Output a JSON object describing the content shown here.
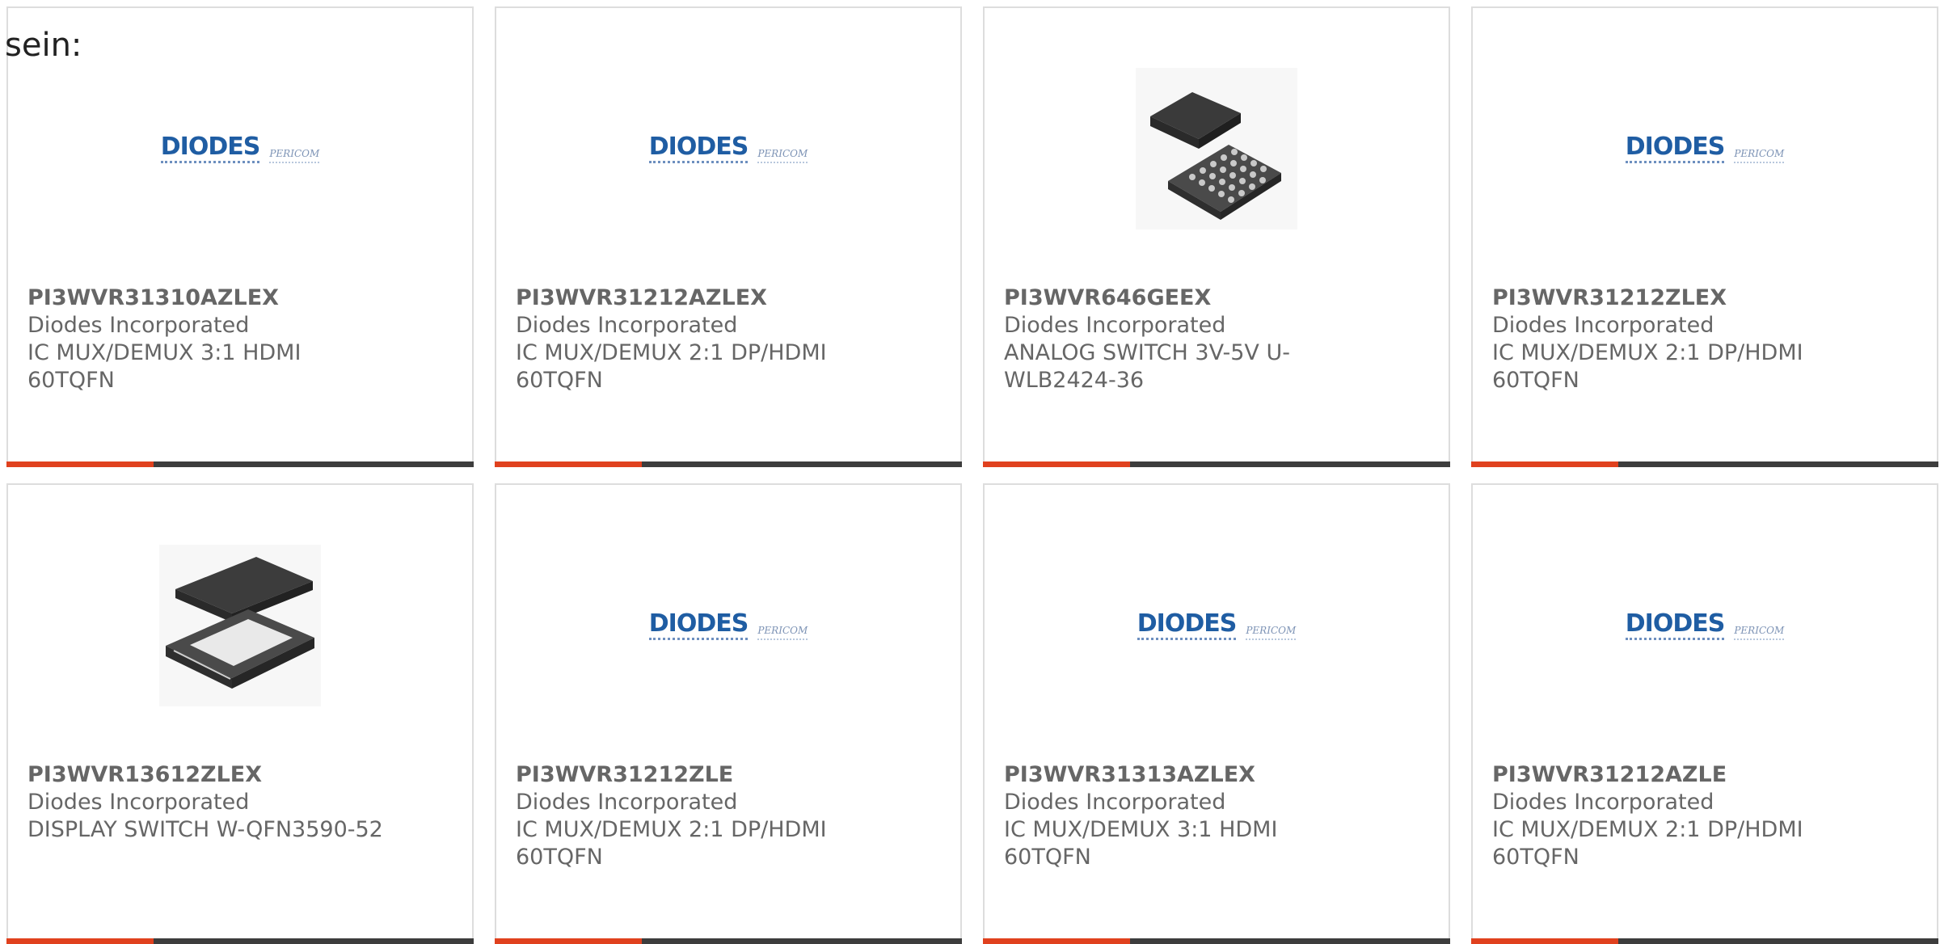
{
  "intro_text": "sein:",
  "accent_color": "#e0411e",
  "bar_color": "#3d3d3d",
  "logo": {
    "brand": "DIODES",
    "sub": "PERICOM"
  },
  "products": [
    {
      "part": "PI3WVR31310AZLEX",
      "manufacturer": "Diodes Incorporated",
      "desc1": "IC MUX/DEMUX 3:1 HDMI",
      "desc2": "60TQFN",
      "image": "diodes-logo"
    },
    {
      "part": "PI3WVR31212AZLEX",
      "manufacturer": "Diodes Incorporated",
      "desc1": "IC MUX/DEMUX 2:1 DP/HDMI",
      "desc2": "60TQFN",
      "image": "diodes-logo"
    },
    {
      "part": "PI3WVR646GEEX",
      "manufacturer": "Diodes Incorporated",
      "desc1": "ANALOG SWITCH 3V-5V U-",
      "desc2": "WLB2424-36",
      "image": "bga-chip"
    },
    {
      "part": "PI3WVR31212ZLEX",
      "manufacturer": "Diodes Incorporated",
      "desc1": "IC MUX/DEMUX 2:1 DP/HDMI",
      "desc2": "60TQFN",
      "image": "diodes-logo"
    },
    {
      "part": "PI3WVR13612ZLEX",
      "manufacturer": "Diodes Incorporated",
      "desc1": "DISPLAY SWITCH W-QFN3590-52",
      "desc2": "",
      "image": "qfn-chip"
    },
    {
      "part": "PI3WVR31212ZLE",
      "manufacturer": "Diodes Incorporated",
      "desc1": "IC MUX/DEMUX 2:1 DP/HDMI",
      "desc2": "60TQFN",
      "image": "diodes-logo"
    },
    {
      "part": "PI3WVR31313AZLEX",
      "manufacturer": "Diodes Incorporated",
      "desc1": "IC MUX/DEMUX 3:1 HDMI",
      "desc2": "60TQFN",
      "image": "diodes-logo"
    },
    {
      "part": "PI3WVR31212AZLE",
      "manufacturer": "Diodes Incorporated",
      "desc1": "IC MUX/DEMUX 2:1 DP/HDMI",
      "desc2": "60TQFN",
      "image": "diodes-logo"
    }
  ]
}
